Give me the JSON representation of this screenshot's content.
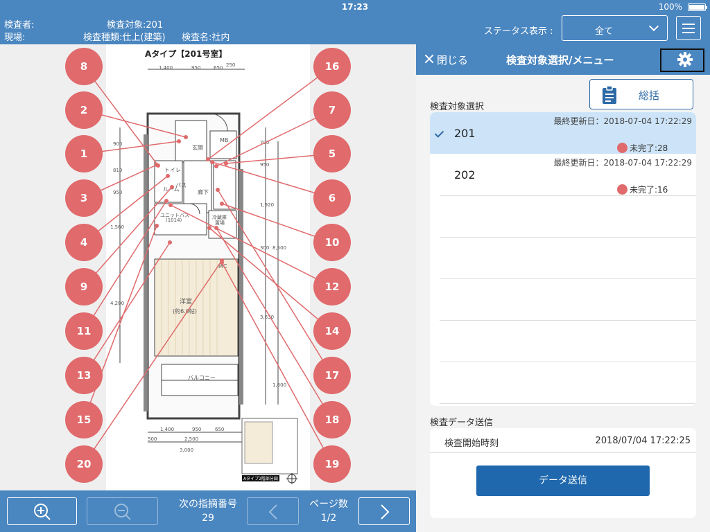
{
  "status_bar": {
    "time": "17:23",
    "battery": "100%"
  },
  "header": {
    "inspector_label": "検査者:",
    "site_label": "現場:",
    "target": "検査対象:201",
    "type": "検査種類:仕上(建築)",
    "name": "検査名:社内",
    "status_label": "ステータス表示 :",
    "status_value": "全て"
  },
  "drawing": {
    "title": "Aタイプ【201号室】",
    "dims_top": [
      "1,400",
      "950",
      "650",
      "250"
    ],
    "dims_bottom_1": [
      "1,400",
      "950",
      "650"
    ],
    "dims_bottom_2": [
      "500",
      "2,500"
    ],
    "dims_bottom_3": "3,000",
    "dims_left": [
      "900",
      "810",
      "950",
      "1,560",
      "4,280"
    ],
    "dims_right": [
      "700",
      "950",
      "1,920",
      "300",
      "8,500",
      "3,630",
      "1,600"
    ],
    "room_labels": {
      "genkan": "玄関",
      "mb": "MB",
      "toilet": "トイレ",
      "bath": "バス",
      "room": "ルーム",
      "hall": "廊下",
      "unit_bath": "ユニットバス",
      "unit_bath_size": "(1014)",
      "fridge": "冷蔵庫",
      "fridge2": "置場",
      "western": "洋室",
      "western_size": "(約6.0帖)",
      "balcony": "バルコニー",
      "mc": "MC",
      "key_plan": "Aタイプ2階部分図"
    },
    "pins": [
      {
        "id": "8",
        "label": "8"
      },
      {
        "id": "2",
        "label": "2"
      },
      {
        "id": "1",
        "label": "1"
      },
      {
        "id": "3",
        "label": "3"
      },
      {
        "id": "4",
        "label": "4"
      },
      {
        "id": "9",
        "label": "9"
      },
      {
        "id": "11",
        "label": "11"
      },
      {
        "id": "13",
        "label": "13"
      },
      {
        "id": "15",
        "label": "15"
      },
      {
        "id": "20",
        "label": "20"
      },
      {
        "id": "16",
        "label": "16"
      },
      {
        "id": "7",
        "label": "7"
      },
      {
        "id": "5",
        "label": "5"
      },
      {
        "id": "6",
        "label": "6"
      },
      {
        "id": "10",
        "label": "10"
      },
      {
        "id": "12",
        "label": "12"
      },
      {
        "id": "14",
        "label": "14"
      },
      {
        "id": "17",
        "label": "17"
      },
      {
        "id": "18",
        "label": "18"
      },
      {
        "id": "19",
        "label": "19"
      }
    ],
    "pin_color": "#e06a6c"
  },
  "bottom_bar": {
    "next_label": "次の指摘番号",
    "next_value": "29",
    "page_label": "ページ数",
    "page_value": "1/2"
  },
  "panel": {
    "close_label": "閉じる",
    "title": "検査対象選択/メニュー",
    "summary_label": "総括",
    "target_section_label": "検査対象選択",
    "items": [
      {
        "name": "201",
        "updated": "最終更新日：2018-07-04 17:22:29",
        "status": "未完了:28",
        "selected": true
      },
      {
        "name": "202",
        "updated": "最終更新日：2018-07-04 17:22:29",
        "status": "未完了:16",
        "selected": false
      }
    ],
    "send_section_label": "検査データ送信",
    "start_time_label": "検査開始時刻",
    "start_time_value": "2018/07/04 17:22:25",
    "send_label": "データ送信"
  },
  "colors": {
    "header_blue": "#4a86c0",
    "accent_blue": "#1f68ad",
    "pin_red": "#e06a6c",
    "selected_row": "#cde4f8"
  },
  "icons": [
    "battery-icon",
    "chevron-down-icon",
    "hamburger-menu-icon",
    "close-icon",
    "gear-icon",
    "clipboard-icon",
    "zoom-in-icon",
    "zoom-out-icon",
    "chevron-left-icon",
    "chevron-right-icon",
    "checkmark-icon",
    "compass-icon"
  ]
}
